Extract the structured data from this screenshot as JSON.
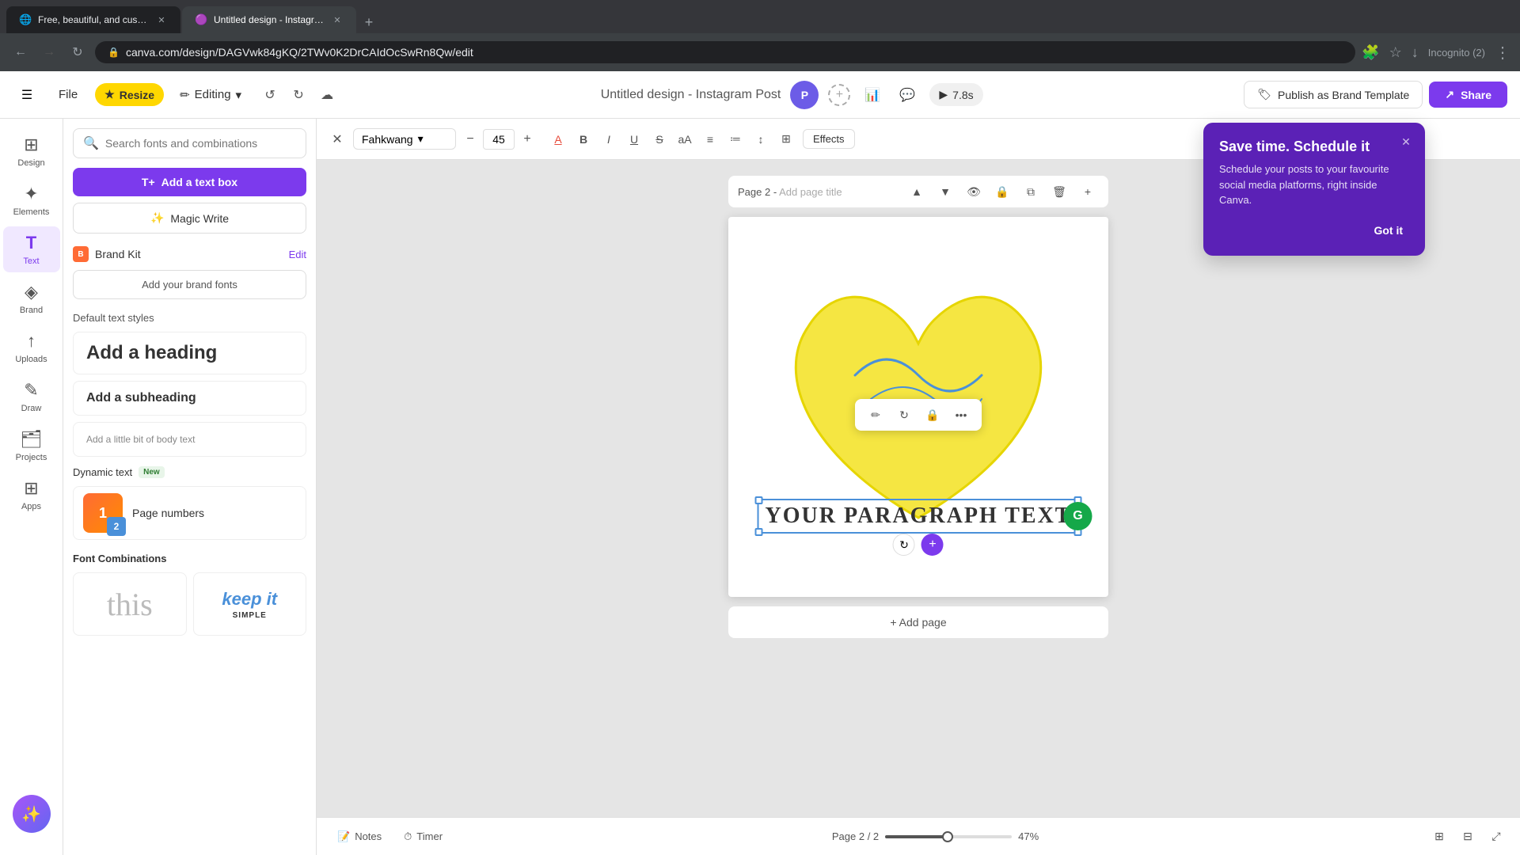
{
  "browser": {
    "tabs": [
      {
        "id": "tab1",
        "title": "Free, beautiful, and customizab...",
        "favicon": "🌐",
        "active": false
      },
      {
        "id": "tab2",
        "title": "Untitled design - Instagram Po...",
        "favicon": "🟣",
        "active": true
      }
    ],
    "url": "canva.com/design/DAGVwk84gKQ/2TWv0K2DrCAIdOcSwRn8Qw/edit",
    "incognito": "Incognito (2)"
  },
  "toolbar": {
    "file_label": "File",
    "resize_label": "Resize",
    "editing_label": "Editing",
    "design_title": "Untitled design - Instagram Post",
    "publish_label": "Publish as Brand Template",
    "share_label": "Share",
    "play_time": "7.8s"
  },
  "text_panel": {
    "search_placeholder": "Search fonts and combinations",
    "add_text_box_label": "Add a text box",
    "magic_write_label": "Magic Write",
    "brand_kit_label": "Brand Kit",
    "edit_label": "Edit",
    "add_brand_fonts_label": "Add your brand fonts",
    "default_styles_title": "Default text styles",
    "heading_label": "Add a heading",
    "subheading_label": "Add a subheading",
    "body_label": "Add a little bit of body text",
    "dynamic_text_title": "Dynamic text",
    "dynamic_text_badge": "New",
    "page_numbers_label": "Page numbers",
    "font_combinations_title": "Font Combinations",
    "font_combo_1": "this",
    "font_combo_2_line1": "keep it",
    "font_combo_2_line2": "SIMPLE"
  },
  "canvas": {
    "page_label": "Page 2",
    "page_title_placeholder": "Add page title",
    "selected_text": "YOUR PARAGRAPH TEXT",
    "add_page_label": "+ Add page"
  },
  "text_toolbar": {
    "font_name": "Fahkwang",
    "font_size": "45",
    "effects_label": "Effects"
  },
  "bottom_bar": {
    "notes_label": "Notes",
    "timer_label": "Timer",
    "page_current": "Page 2 / 2",
    "zoom_level": "47%"
  },
  "notification": {
    "title": "Save time. Schedule it",
    "body": "Schedule your posts to your favourite social media platforms, right inside Canva.",
    "button_label": "Got it"
  },
  "side_icons": [
    {
      "id": "design",
      "label": "Design",
      "symbol": "⊞",
      "active": false
    },
    {
      "id": "elements",
      "label": "Elements",
      "symbol": "✦",
      "active": false
    },
    {
      "id": "text",
      "label": "Text",
      "symbol": "T",
      "active": true
    },
    {
      "id": "brand",
      "label": "Brand",
      "symbol": "◈",
      "active": false
    },
    {
      "id": "uploads",
      "label": "Uploads",
      "symbol": "↑",
      "active": false
    },
    {
      "id": "draw",
      "label": "Draw",
      "symbol": "✎",
      "active": false
    },
    {
      "id": "projects",
      "label": "Projects",
      "symbol": "⊡",
      "active": false
    },
    {
      "id": "apps",
      "label": "Apps",
      "symbol": "⊞",
      "active": false
    }
  ]
}
